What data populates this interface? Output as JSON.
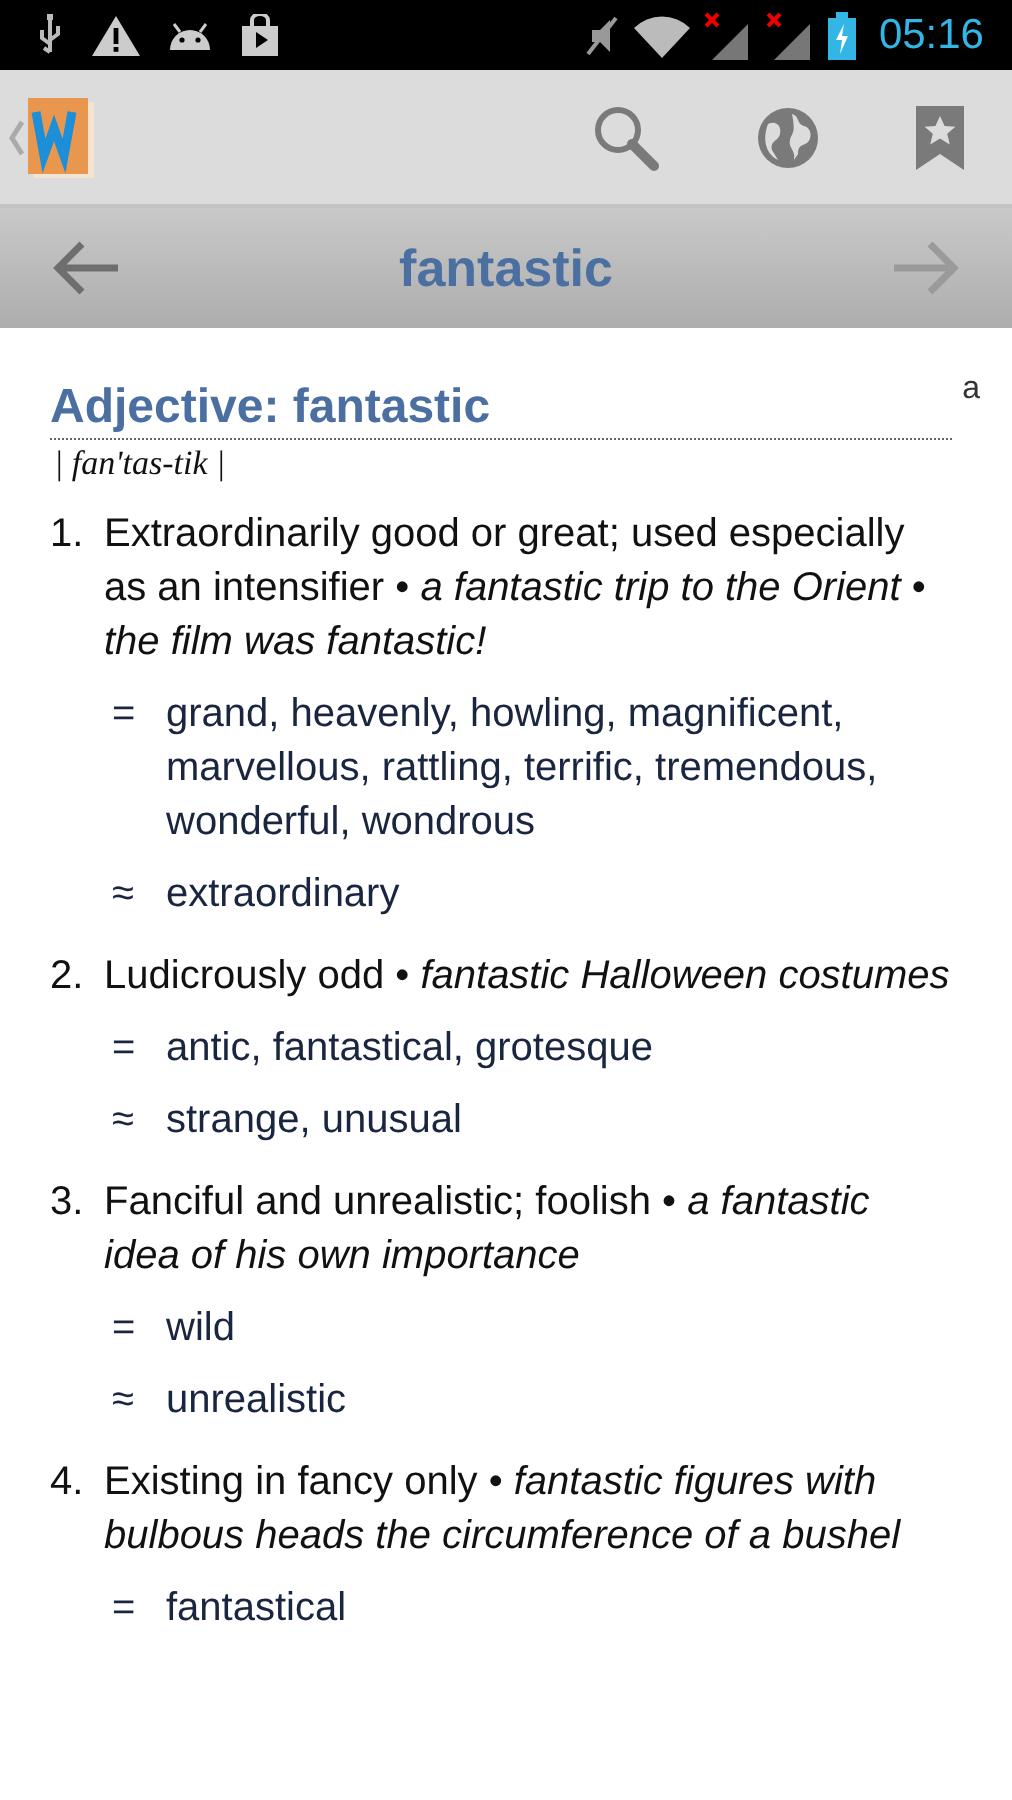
{
  "status_bar": {
    "time": "05:16"
  },
  "word_bar": {
    "word": "fantastic"
  },
  "entry": {
    "heading": "Adjective: fantastic",
    "corner_label": "a",
    "pronunciation": "| fan'tas-tik |",
    "senses": [
      {
        "number": "1.",
        "text": "Extraordinarily good or great; used especially as an intensifier • *a fantastic trip to the Orient* • *the film was fantastic!*",
        "relations": [
          {
            "symbol": "=",
            "words": "grand, heavenly, howling, magnificent, marvellous, rattling, terrific, tremendous, wonderful, wondrous"
          },
          {
            "symbol": "≈",
            "words": "extraordinary"
          }
        ]
      },
      {
        "number": "2.",
        "text": "Ludicrously odd • *fantastic Halloween costumes*",
        "relations": [
          {
            "symbol": "=",
            "words": "antic, fantastical, grotesque"
          },
          {
            "symbol": "≈",
            "words": "strange, unusual"
          }
        ]
      },
      {
        "number": "3.",
        "text": "Fanciful and unrealistic; foolish • *a fantastic idea of his own importance*",
        "relations": [
          {
            "symbol": "=",
            "words": "wild"
          },
          {
            "symbol": "≈",
            "words": "unrealistic"
          }
        ]
      },
      {
        "number": "4.",
        "text": "Existing in fancy only • *fantastic figures with bulbous heads the circumference of a bushel*",
        "relations": [
          {
            "symbol": "=",
            "words": "fantastical"
          }
        ]
      }
    ]
  }
}
